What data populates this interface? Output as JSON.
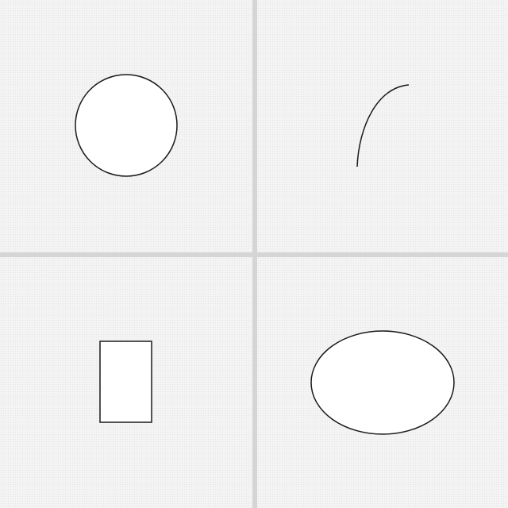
{
  "canvas": {
    "background": "#f5f5f5",
    "divider_color": "#d5d5d5",
    "stroke_color": "#1a1a1a",
    "shape_fill": "#ffffff"
  },
  "panels": [
    {
      "name": "panel-top-left",
      "shape": "circle"
    },
    {
      "name": "panel-top-right",
      "shape": "arc"
    },
    {
      "name": "panel-bottom-left",
      "shape": "rectangle"
    },
    {
      "name": "panel-bottom-right",
      "shape": "ellipse"
    }
  ]
}
